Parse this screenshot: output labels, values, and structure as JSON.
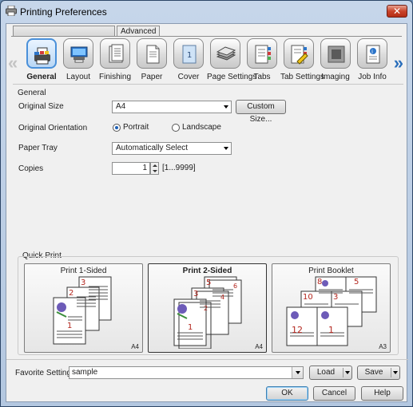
{
  "window": {
    "title": "Printing Preferences",
    "close_label": "✕"
  },
  "tabs": [
    {
      "label": ""
    },
    {
      "label": "Advanced"
    }
  ],
  "toolbar": {
    "items": [
      {
        "label": "General",
        "icon": "printer-general-icon"
      },
      {
        "label": "Layout",
        "icon": "layout-icon"
      },
      {
        "label": "Finishing",
        "icon": "finishing-icon"
      },
      {
        "label": "Paper",
        "icon": "paper-icon"
      },
      {
        "label": "Cover",
        "icon": "cover-icon"
      },
      {
        "label": "Page Settings",
        "icon": "page-settings-icon"
      },
      {
        "label": "Tabs",
        "icon": "tabs-icon"
      },
      {
        "label": "Tab Settings",
        "icon": "tab-settings-icon"
      },
      {
        "label": "Imaging",
        "icon": "imaging-icon"
      },
      {
        "label": "Job Info",
        "icon": "job-info-icon"
      }
    ],
    "selected": "General"
  },
  "general": {
    "section_label": "General",
    "original_size": {
      "label": "Original Size",
      "value": "A4",
      "custom_button": "Custom Size..."
    },
    "orientation": {
      "label": "Original Orientation",
      "portrait": "Portrait",
      "landscape": "Landscape",
      "selected": "Portrait"
    },
    "paper_tray": {
      "label": "Paper Tray",
      "value": "Automatically Select"
    },
    "copies": {
      "label": "Copies",
      "value": "1",
      "range": "[1...9999]"
    }
  },
  "quick_print": {
    "label": "Quick Print",
    "cards": [
      {
        "title": "Print 1-Sided",
        "size": "A4",
        "pages": [
          "3",
          "2",
          "1"
        ]
      },
      {
        "title": "Print 2-Sided",
        "size": "A4",
        "pages": [
          "5",
          "6",
          "3",
          "4",
          "1",
          "2"
        ]
      },
      {
        "title": "Print Booklet",
        "size": "A3",
        "pages": [
          "8",
          "5",
          "10",
          "3",
          "12",
          "1"
        ]
      }
    ]
  },
  "footer": {
    "favorite_label": "Favorite Setting",
    "favorite_value": "sample",
    "load_label": "Load",
    "save_label": "Save",
    "ok_label": "OK",
    "cancel_label": "Cancel",
    "help_label": "Help"
  }
}
